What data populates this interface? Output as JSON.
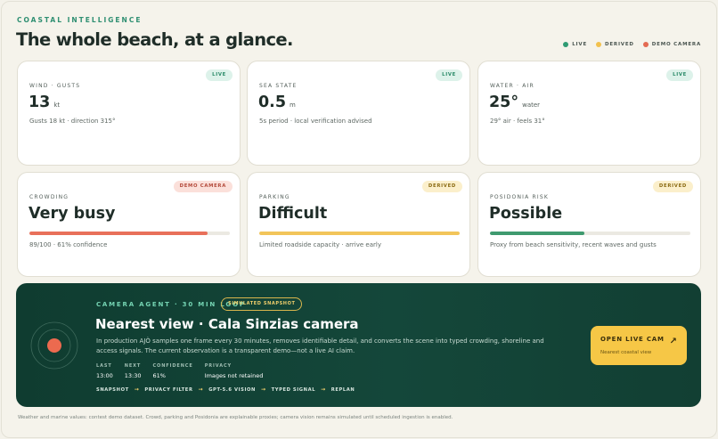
{
  "header": {
    "eyebrow": "COASTAL INTELLIGENCE",
    "title": "The whole beach, at a glance.",
    "legend": [
      {
        "label": "LIVE",
        "color": "#2f9b73"
      },
      {
        "label": "DERIVED",
        "color": "#f2c14e"
      },
      {
        "label": "DEMO CAMERA",
        "color": "#e36a52"
      }
    ]
  },
  "cards": {
    "wind": {
      "label": "WIND · GUSTS",
      "badge": "LIVE",
      "value": "13",
      "unit": "kt",
      "sub": "Gusts 18 kt · direction 315°"
    },
    "sea": {
      "label": "SEA STATE",
      "badge": "LIVE",
      "value": "0.5",
      "unit": "m",
      "sub": "5s period · local verification advised"
    },
    "water": {
      "label": "WATER · AIR",
      "badge": "LIVE",
      "value": "25°",
      "unit": "water",
      "sub": "29° air · feels 31°"
    },
    "crowding": {
      "label": "CROWDING",
      "badge": "DEMO CAMERA",
      "value": "Very busy",
      "level": 0.89,
      "bar_color": "#e8705a",
      "sub": "89/100 · 61% confidence"
    },
    "parking": {
      "label": "PARKING",
      "badge": "DERIVED",
      "value": "Difficult",
      "level": 1.0,
      "bar_color": "#f2c55a",
      "sub": "Limited roadside capacity · arrive early"
    },
    "posidonia": {
      "label": "POSIDONIA RISK",
      "badge": "DERIVED",
      "value": "Possible",
      "level": 0.47,
      "bar_color": "#3f9a6f",
      "sub": "Proxy from beach sensitivity, recent waves and gusts"
    }
  },
  "agent": {
    "eyebrow": "CAMERA AGENT · 30 MIN LOOP",
    "badge": "SIMULATED SNAPSHOT",
    "title": "Nearest view · Cala Sinzias camera",
    "description": "In production AJÒ samples one frame every 30 minutes, removes identifiable detail, and converts the scene into typed crowding, shoreline and access signals. The current observation is a transparent demo—not a live AI claim.",
    "stats": [
      {
        "label": "LAST",
        "value": "13:00"
      },
      {
        "label": "NEXT",
        "value": "13:30"
      },
      {
        "label": "CONFIDENCE",
        "value": "61%"
      },
      {
        "label": "PRIVACY",
        "value": "Images not retained"
      }
    ],
    "pipeline": [
      "SNAPSHOT",
      "PRIVACY FILTER",
      "GPT-5.6 VISION",
      "TYPED SIGNAL",
      "REPLAN"
    ],
    "pipeline_arrow": "→",
    "button": {
      "label": "OPEN LIVE CAM",
      "sub": "Nearest coastal view",
      "arrow": "↗"
    }
  },
  "footnote": "Weather and marine values: contest demo dataset. Crowd, parking and Posidonia are explainable proxies; camera vision remains simulated until scheduled ingestion is enabled."
}
